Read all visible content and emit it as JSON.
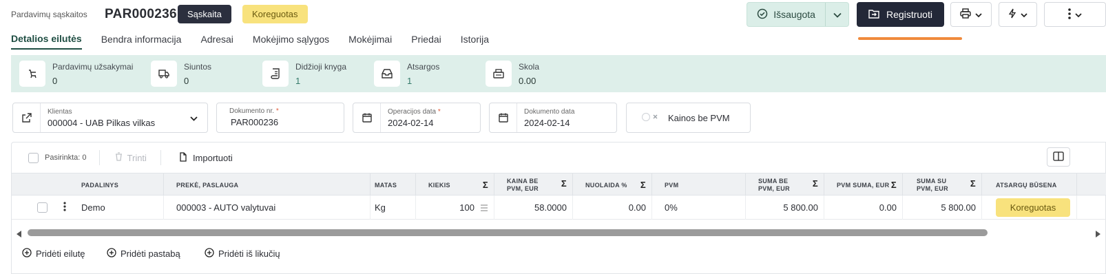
{
  "header": {
    "breadcrumb": "Pardavimų sąskaitos",
    "doc_number": "PAR000236",
    "type_badge": "Sąskaita",
    "status_badge": "Koreguotas",
    "saved_label": "Išsaugota",
    "register_label": "Registruoti"
  },
  "tabs": [
    "Detalios eilutės",
    "Bendra informacija",
    "Adresai",
    "Mokėjimo sąlygos",
    "Mokėjimai",
    "Priedai",
    "Istorija"
  ],
  "summary": [
    {
      "label": "Pardavimų užsakymai",
      "value": "0",
      "icon": "cart-icon"
    },
    {
      "label": "Siuntos",
      "value": "0",
      "icon": "truck-icon"
    },
    {
      "label": "Didžioji knyga",
      "value": "1",
      "icon": "ledger-icon"
    },
    {
      "label": "Atsargos",
      "value": "1",
      "icon": "inbox-icon"
    },
    {
      "label": "Skola",
      "value": "0.00",
      "icon": "register-icon"
    }
  ],
  "fields": {
    "client_label": "Klientas",
    "client_value": "000004 - UAB Pilkas vilkas",
    "docno_label": "Dokumento nr.",
    "docno_value": "PAR000236",
    "opdate_label": "Operacijos data",
    "opdate_value": "2024-02-14",
    "docdate_label": "Dokumento data",
    "docdate_value": "2024-02-14",
    "vat_toggle_label": "Kainos be PVM",
    "required_mark": "*"
  },
  "toolbar": {
    "selected": "Pasirinkta: 0",
    "delete": "Trinti",
    "import": "Importuoti"
  },
  "table": {
    "columns": [
      "PADALINYS",
      "PREKĖ, PASLAUGA",
      "MATAS",
      "KIEKIS",
      "KAINA BE PVM, EUR",
      "NUOLAIDA %",
      "PVM",
      "SUMA BE PVM, EUR",
      "PVM SUMA, EUR",
      "SUMA SU PVM, EUR",
      "ATSARGŲ BŪSENA"
    ],
    "sigma": "Σ",
    "rows": [
      {
        "unit": "Demo",
        "item": "000003 - AUTO valytuvai",
        "measure": "Kg",
        "qty": "100",
        "price": "58.0000",
        "discount": "0.00",
        "vat": "0%",
        "sum_novat": "5 800.00",
        "vat_sum": "0.00",
        "sum_vat": "5 800.00",
        "stock_status": "Koreguotas"
      }
    ]
  },
  "actions": [
    "Pridėti eilutę",
    "Pridėti pastabą",
    "Pridėti iš likučių"
  ],
  "colors": {
    "accent": "#1f4e43",
    "band": "#deefea",
    "dark": "#232838",
    "yellow": "#f8e27d",
    "orange": "#f08a3c"
  }
}
